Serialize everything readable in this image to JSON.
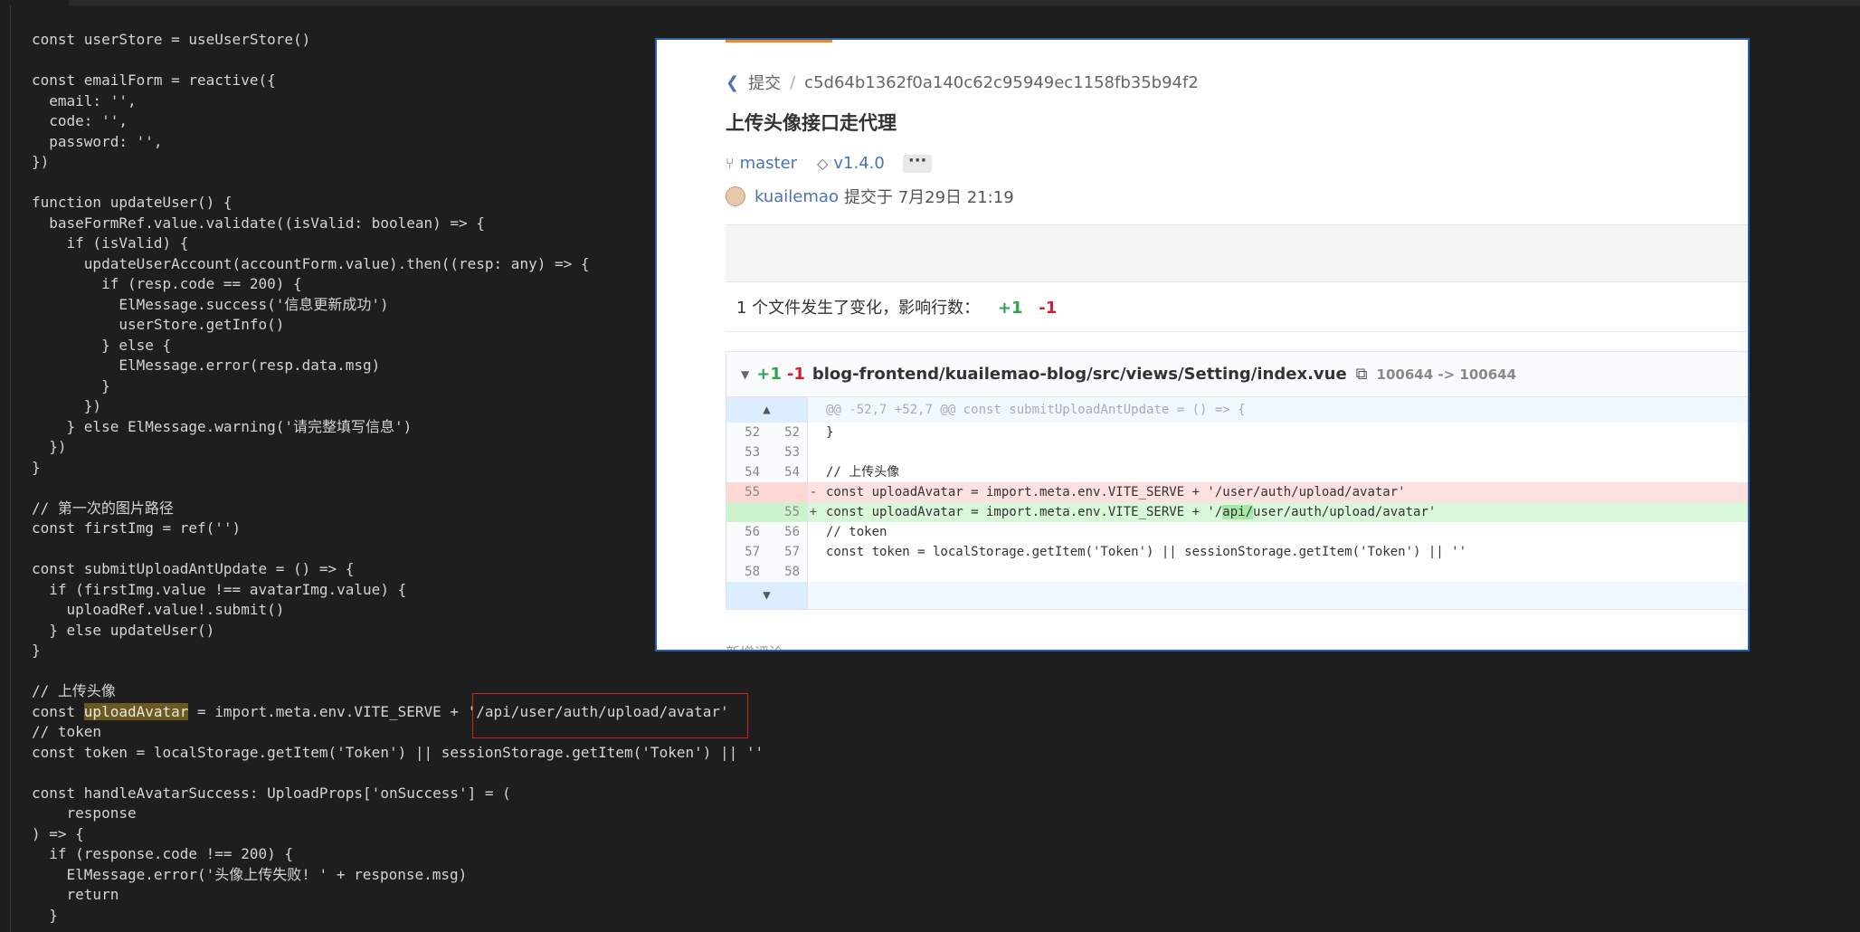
{
  "editor": {
    "lines": [
      "const userStore = useUserStore()",
      "",
      "const emailForm = reactive({",
      "  email: '',",
      "  code: '',",
      "  password: '',",
      "})",
      "",
      "function updateUser() {",
      "  baseFormRef.value.validate((isValid: boolean) => {",
      "    if (isValid) {",
      "      updateUserAccount(accountForm.value).then((resp: any) => {",
      "        if (resp.code == 200) {",
      "          ElMessage.success('信息更新成功')",
      "          userStore.getInfo()",
      "        } else {",
      "          ElMessage.error(resp.data.msg)",
      "        }",
      "      })",
      "    } else ElMessage.warning('请完整填写信息')",
      "  })",
      "}",
      "",
      "// 第一次的图片路径",
      "const firstImg = ref('')",
      "",
      "const submitUploadAntUpdate = () => {",
      "  if (firstImg.value !== avatarImg.value) {",
      "    uploadRef.value!.submit()",
      "  } else updateUser()",
      "}",
      "",
      "// 上传头像",
      null,
      "// token",
      "const token = localStorage.getItem('Token') || sessionStorage.getItem('Token') || ''",
      "",
      "const handleAvatarSuccess: UploadProps['onSuccess'] = (",
      "    response",
      ") => {",
      "  if (response.code !== 200) {",
      "    ElMessage.error('头像上传失败! ' + response.msg)",
      "    return",
      "  }"
    ],
    "highlight_line": {
      "prefix": "const ",
      "highlighted": "uploadAvatar",
      "suffix": " = import.meta.env.VITE_SERVE + '/api/user/auth/upload/avatar'"
    }
  },
  "commit": {
    "breadcrumb_label": "提交",
    "hash": "c5d64b1362f0a140c62c95949ec1158fb35b94f2",
    "title": "上传头像接口走代理",
    "branch": "master",
    "tag": "v1.4.0",
    "more": "···",
    "author": "kuailemao",
    "commit_text": "提交于 7月29日 21:19",
    "summary_text": "1 个文件发生了变化，影响行数：",
    "summary_add": "+1",
    "summary_del": "-1",
    "file": {
      "add": "+1",
      "del": "-1",
      "path": "blog-frontend/kuailemao-blog/src/views/Setting/index.vue",
      "mode": "100644 -> 100644"
    },
    "hunk_header": "@@ -52,7 +52,7 @@ const submitUploadAntUpdate = () => {",
    "diff_rows": [
      {
        "old": "52",
        "new": "52",
        "sign": "",
        "text": "}",
        "type": "ctx"
      },
      {
        "old": "53",
        "new": "53",
        "sign": "",
        "text": "",
        "type": "ctx"
      },
      {
        "old": "54",
        "new": "54",
        "sign": "",
        "text": "// 上传头像",
        "type": "ctx"
      },
      {
        "old": "55",
        "new": "",
        "sign": "-",
        "text": "const uploadAvatar = import.meta.env.VITE_SERVE + '/user/auth/upload/avatar'",
        "type": "del"
      },
      {
        "old": "",
        "new": "55",
        "sign": "+",
        "text": "const uploadAvatar = import.meta.env.VITE_SERVE + '/api/user/auth/upload/avatar'",
        "type": "add"
      },
      {
        "old": "56",
        "new": "56",
        "sign": "",
        "text": "// token",
        "type": "ctx"
      },
      {
        "old": "57",
        "new": "57",
        "sign": "",
        "text": "const token = localStorage.getItem('Token') || sessionStorage.getItem('Token') || ''",
        "type": "ctx"
      },
      {
        "old": "58",
        "new": "58",
        "sign": "",
        "text": "",
        "type": "ctx"
      }
    ],
    "add_parts": {
      "before": "const uploadAvatar = import.meta.env.VITE_SERVE + '/",
      "mark": "api/",
      "after": "user/auth/upload/avatar'"
    },
    "cutoff_text": "新增评论"
  }
}
